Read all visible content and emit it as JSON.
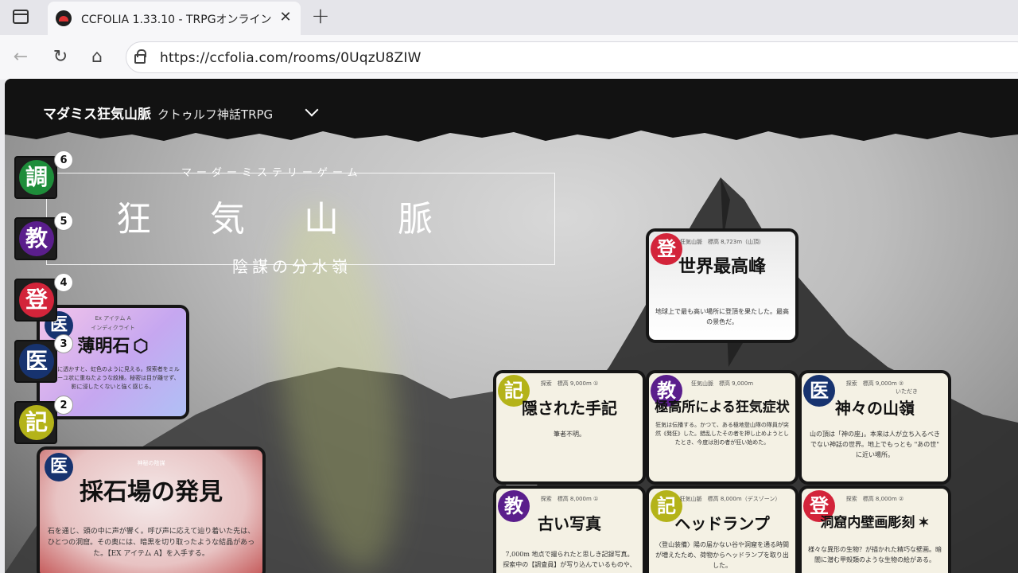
{
  "browser": {
    "tab_title": "CCFOLIA 1.33.10 - TRPGオンラインセ",
    "close_symbol": "✕",
    "new_tab_symbol": "+",
    "back_symbol": "←",
    "reload_symbol": "↻",
    "home_symbol": "⌂",
    "url": "https://ccfolia.com/rooms/0UqzU8ZIW"
  },
  "room": {
    "title": "マダミス狂気山脈",
    "subtitle": "クトゥルフ神話TRPG"
  },
  "banner": {
    "kicker": "マーダーミステリーゲーム",
    "main": "狂気山脈",
    "sub": "陰謀の分水嶺"
  },
  "tokens": [
    {
      "glyph": "調",
      "count": "6",
      "color": "#1e8d3a"
    },
    {
      "glyph": "教",
      "count": "5",
      "color": "#5a1e8c"
    },
    {
      "glyph": "登",
      "count": "4",
      "color": "#d3243a"
    },
    {
      "glyph": "医",
      "count": "3",
      "color": "#17336f"
    },
    {
      "glyph": "記",
      "count": "2",
      "color": "#b4b319"
    }
  ],
  "cards": {
    "peak": {
      "badge": "登",
      "meta": "狂気山脈　標高 8,723m（山頂）",
      "title": "世界最高峰",
      "body": "地球上で最も高い場所に登頂を果たした。最高の景色だ。"
    },
    "hakumei": {
      "badge": "医",
      "meta": "Ex アイテム A",
      "ruby": "インディクライト",
      "title": "薄明石",
      "body": "太陽に透かすと、虹色のように見える。探索者をミルフィーユ状に重ねたような紋様。秘密は目が離せず、影に浸したくないと強く感じる。"
    },
    "quarry": {
      "badge": "医",
      "meta": "神秘の陰謀",
      "title": "採石場の発見",
      "body": "石を通じ、頭の中に声が響く。呼び声に応えて辿り着いた先は、ひとつの洞窟。その奥には、暗黒を切り取ったような結晶があった。【EX アイテム A】を入手する。"
    },
    "journal": {
      "badge": "記",
      "meta": "探索　標高 9,000m ①",
      "title": "隠された手記",
      "body": "筆者不明。"
    },
    "altitude": {
      "badge": "教",
      "meta": "狂気山脈　標高 9,000m",
      "title": "極高所による狂気症状",
      "body": "狂気は伝播する。かつて、ある極地登山隊の隊員が突然《発狂》した。錯乱したその者を押し止めようとしたとき、今度は別の者が狂い始めた。"
    },
    "ridge": {
      "badge": "医",
      "meta": "探索　標高 9,000m ②",
      "ruby": "いただき",
      "title": "神々の山嶺",
      "body": "山の頂は「神の座」。本来は人が立ち入るべきでない神話の世界。地上でもっとも \"あの世\" に近い場所。"
    },
    "photo": {
      "badge": "教",
      "meta": "探索　標高 8,000m ①",
      "title": "古い写真",
      "body": "7,000m 地点で撮られたと思しき記録写真。探索中の【調査員】が写り込んでいるものや、"
    },
    "headlamp": {
      "badge": "記",
      "meta": "狂気山脈　標高 8,000m（デスゾーン）",
      "title": "ヘッドランプ",
      "body": "〈登山装備〉陽の届かない谷や洞窟を通る時間が増えたため、荷物からヘッドランプを取り出した。"
    },
    "mural": {
      "badge": "登",
      "meta": "探索　標高 8,000m ②",
      "title": "洞窟内壁画彫刻",
      "body": "様々な異形の生物？が描かれた精巧な壁画。暗闇に潜む甲殻類のような生物の絵がある。"
    }
  }
}
